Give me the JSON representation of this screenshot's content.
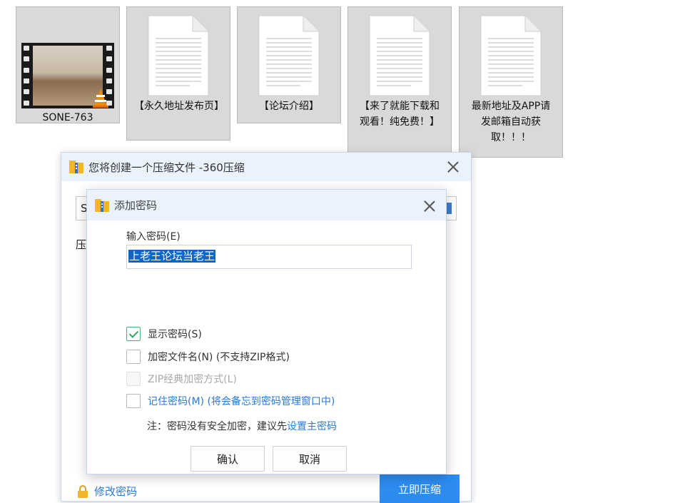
{
  "files": [
    {
      "name": "SONE-763",
      "kind": "video",
      "icon": "vlc-video-icon"
    },
    {
      "name": "【永久地址发布页】",
      "kind": "document",
      "icon": "document-icon"
    },
    {
      "name": "【论坛介绍】",
      "kind": "document",
      "icon": "document-icon"
    },
    {
      "name": "【来了就能下载和观看！纯免费！】",
      "kind": "document",
      "icon": "document-icon"
    },
    {
      "name": "最新地址及APP请发邮箱自动获取！！！",
      "kind": "document",
      "icon": "document-icon"
    }
  ],
  "compress_window": {
    "title": "您将创建一个压缩文件 -360压缩",
    "path_value": "S",
    "compress_label": "压",
    "modify_password_link": "修改密码",
    "compress_now_button": "立即压缩"
  },
  "password_dialog": {
    "title": "添加密码",
    "field_label": "输入密码(E)",
    "password_value": "上老王论坛当老王",
    "options": {
      "show_password": {
        "label": "显示密码(S)",
        "checked": true
      },
      "encrypt_filenames": {
        "label": "加密文件名(N) (不支持ZIP格式)",
        "checked": false
      },
      "zip_classic": {
        "label": "ZIP经典加密方式(L)",
        "checked": false,
        "disabled": true
      },
      "remember_password": {
        "label": "记住密码(M) (将会备忘到密码管理窗口中)",
        "checked": false
      }
    },
    "note_prefix": "注：密码没有安全加密，建议先",
    "note_link": "设置主密码",
    "ok_button": "确认",
    "cancel_button": "取消"
  },
  "colors": {
    "accent": "#2d8cf0",
    "link": "#2a7ad6",
    "title_bar": "#eaf2fb",
    "selection": "#0a66c8",
    "check": "#3aa36a"
  }
}
